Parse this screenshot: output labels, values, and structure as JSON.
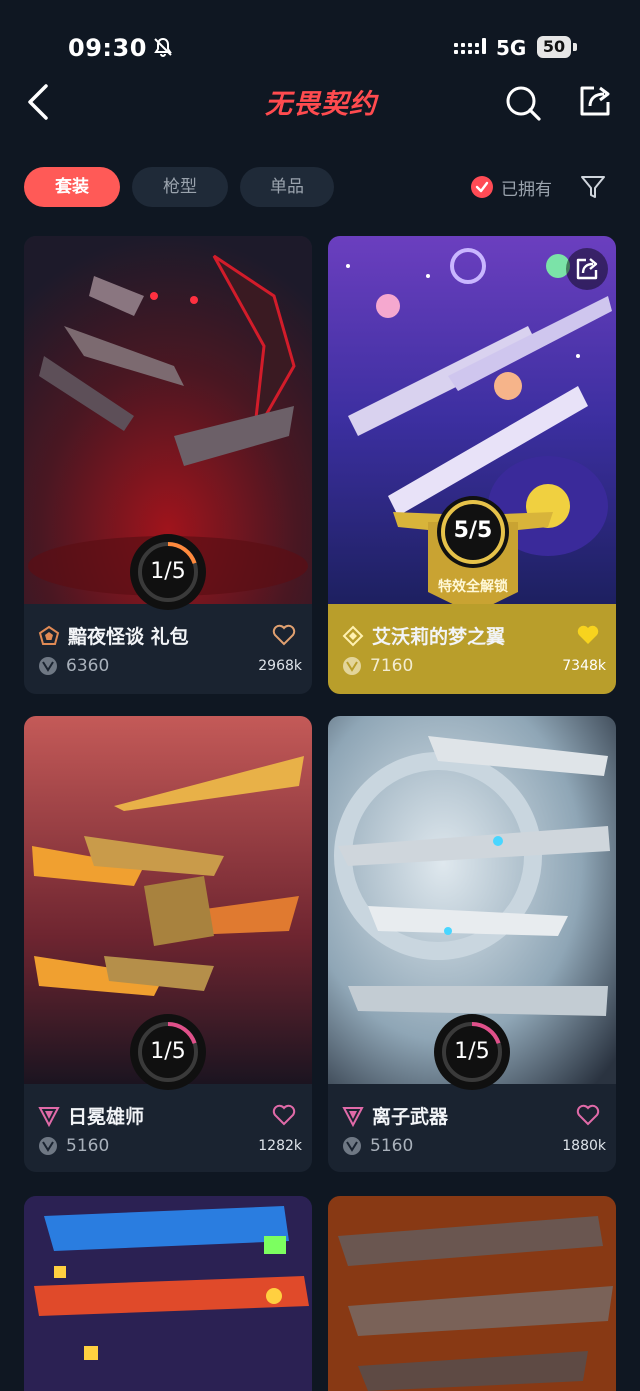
{
  "status": {
    "time": "09:30",
    "network": "5G",
    "battery": "50"
  },
  "header": {
    "title": "无畏契约"
  },
  "tabs": [
    {
      "label": "套装",
      "active": true
    },
    {
      "label": "枪型",
      "active": false
    },
    {
      "label": "单品",
      "active": false
    }
  ],
  "filter": {
    "owned_label": "已拥有"
  },
  "cards": [
    {
      "name": "黯夜怪谈 礼包",
      "price": "6360",
      "likes": "2968k",
      "progress": "1/5",
      "tier": "select"
    },
    {
      "name": "艾沃莉的梦之翼",
      "price": "7160",
      "likes": "7348k",
      "progress": "5/5",
      "badge_label": "特效全解锁",
      "tier": "deluxe"
    },
    {
      "name": "日冕雄师",
      "price": "5160",
      "likes": "1282k",
      "progress": "1/5",
      "tier": "premium"
    },
    {
      "name": "离子武器",
      "price": "5160",
      "likes": "1880k",
      "progress": "1/5",
      "tier": "premium"
    }
  ],
  "colors": {
    "accent": "#ff5a57",
    "background": "#0f1722",
    "gold": "#b99e2b"
  }
}
